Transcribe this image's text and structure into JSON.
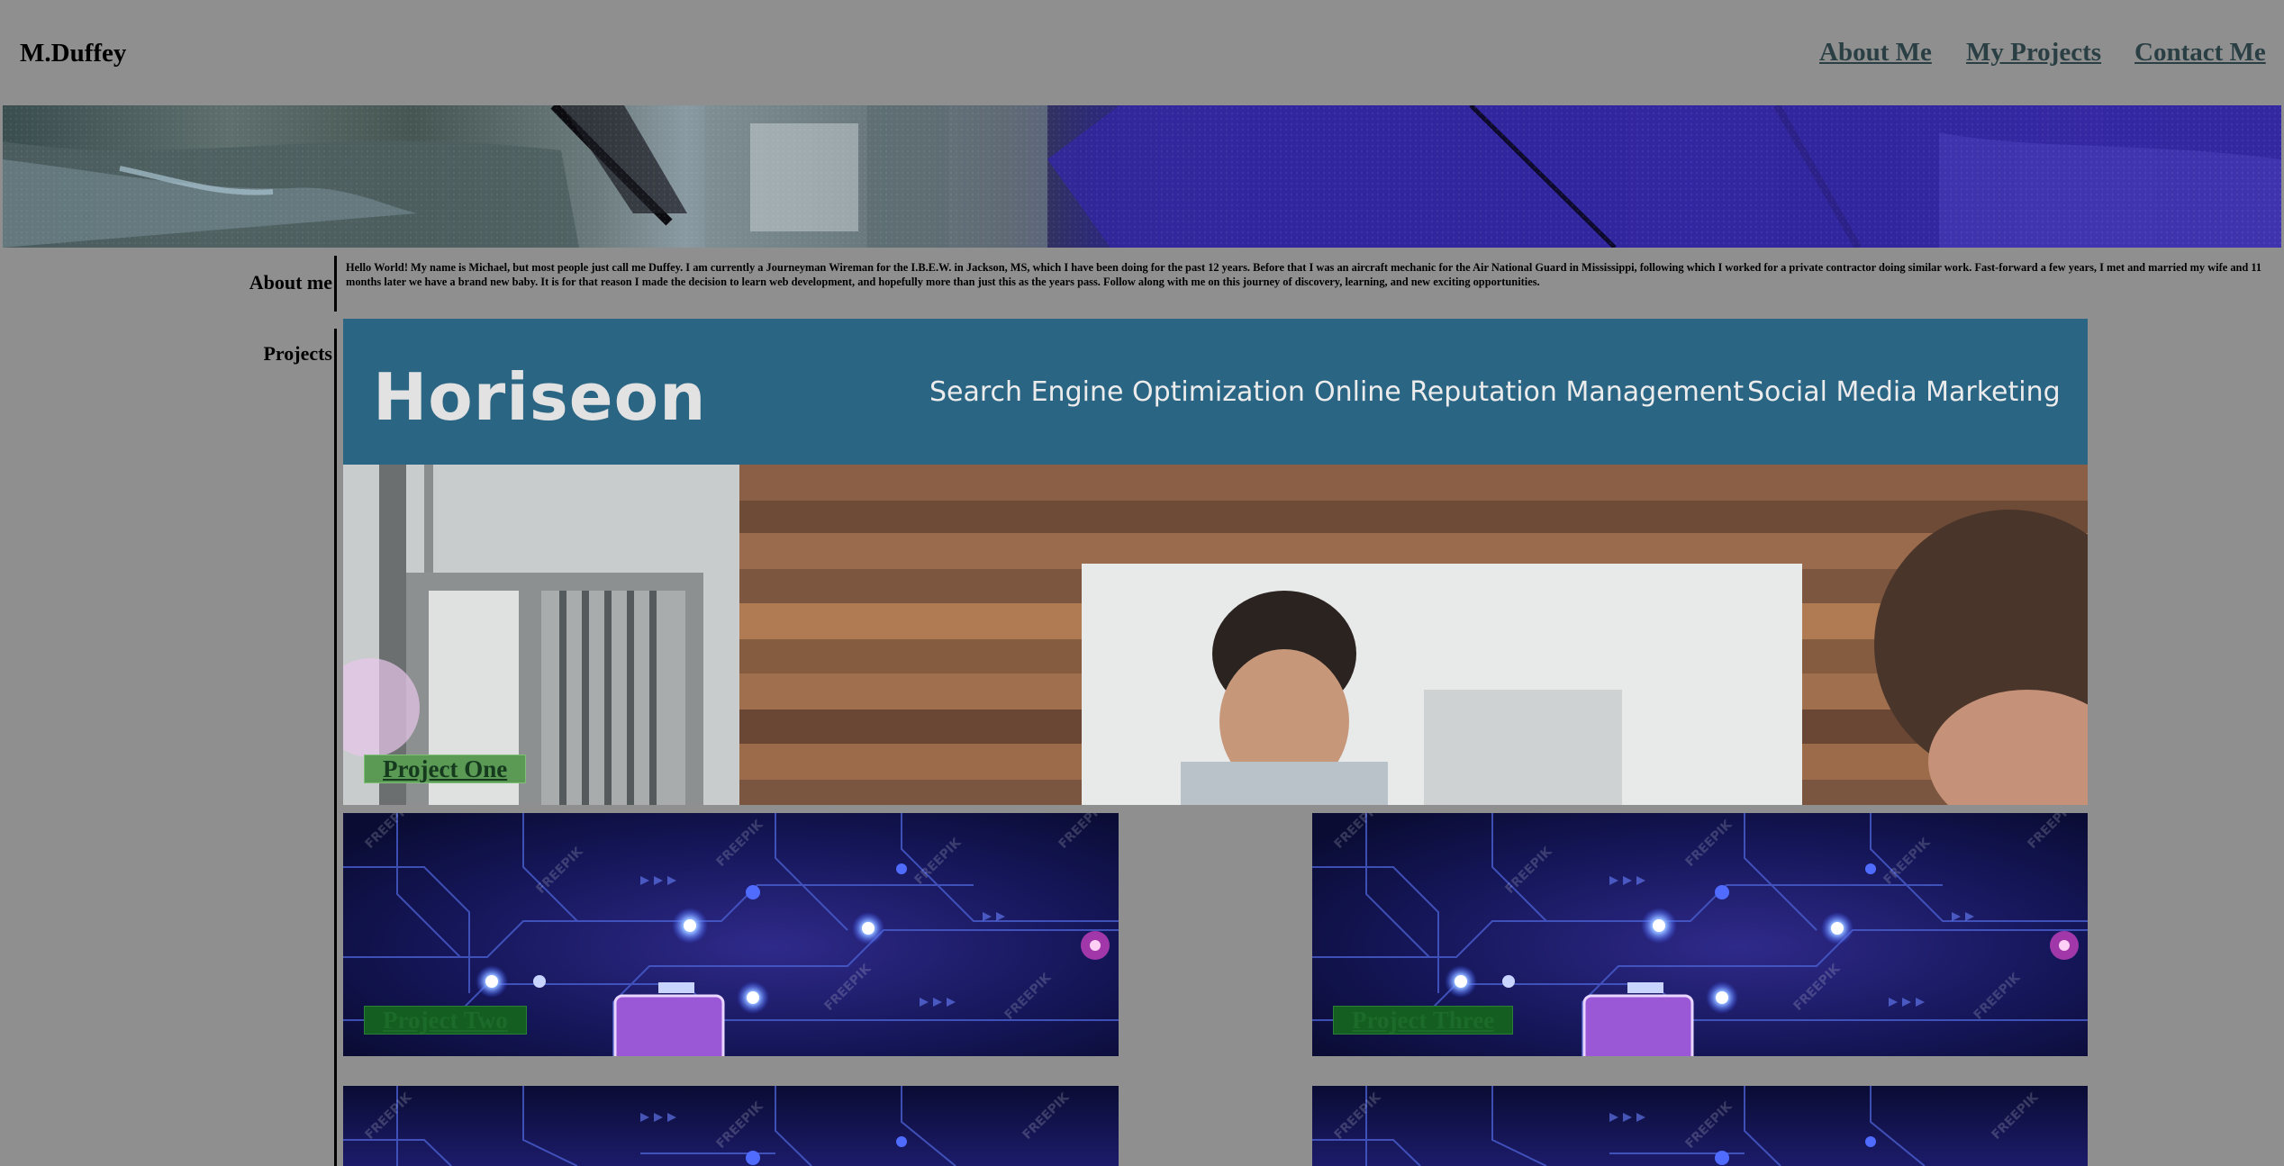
{
  "header": {
    "brand": "M.Duffey",
    "nav": [
      {
        "label": "About Me"
      },
      {
        "label": "My Projects"
      },
      {
        "label": "Contact Me"
      }
    ]
  },
  "about": {
    "heading": "About me",
    "text": "Hello World! My name is Michael, but most people just call me Duffey. I am currently a Journeyman Wireman for the I.B.E.W. in Jackson, MS, which I have been doing for the past 12 years. Before that I was an aircraft mechanic for the Air National Guard in Mississippi, following which I worked for a private contractor doing similar work. Fast-forward a few years, I met and married my wife and 11 months later we have a brand new baby. It is for that reason I made the decision to learn web development, and hopefully more than just this as the years pass. Follow along with me on this journey of discovery, learning, and new exciting opportunities."
  },
  "projects": {
    "heading": "Projects",
    "horiseon": {
      "logo": "Horiseon",
      "nav": [
        "Search Engine Optimization",
        "Online Reputation Management",
        "Social Media Marketing"
      ]
    },
    "items": [
      {
        "label": "Project One"
      },
      {
        "label": "Project Two"
      },
      {
        "label": "Project Three"
      }
    ],
    "watermark": "FREEPIK"
  },
  "colors": {
    "background": "#8f8f8f",
    "nav_link": "#2a3f44",
    "horiseon_bar": "#2b6584",
    "project_one_label": "#5a9a55",
    "project_label_dark": "#155e22"
  }
}
